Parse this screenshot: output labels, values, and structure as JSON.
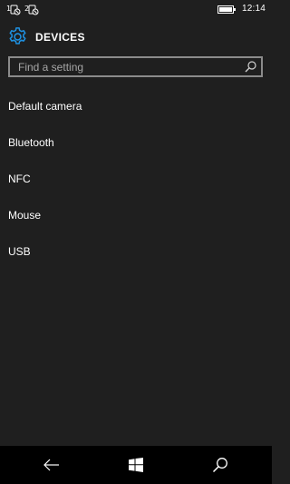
{
  "status_bar": {
    "time": "12:14"
  },
  "header": {
    "title": "DEVICES",
    "icon": "gear-icon",
    "accent_color": "#1e90e0"
  },
  "search": {
    "placeholder": "Find a setting",
    "value": ""
  },
  "settings_list": [
    {
      "label": "Default camera"
    },
    {
      "label": "Bluetooth"
    },
    {
      "label": "NFC"
    },
    {
      "label": "Mouse"
    },
    {
      "label": "USB"
    }
  ],
  "nav_bar": {
    "buttons": [
      "back-icon",
      "windows-start-icon",
      "search-icon"
    ]
  }
}
